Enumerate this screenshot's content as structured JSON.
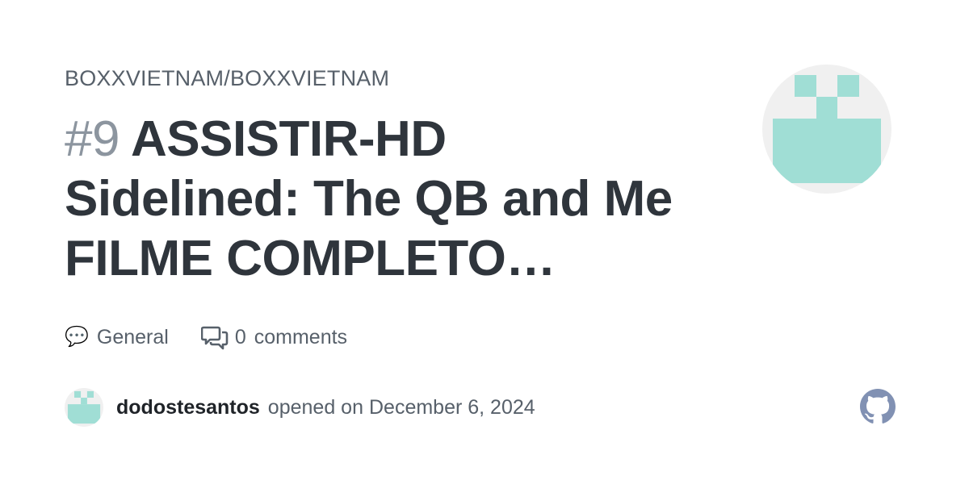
{
  "repo": {
    "path": "BOXXVIETNAM/BOXXVIETNAM"
  },
  "issue": {
    "number": "#9",
    "title": "ASSISTIR-HD Sidelined: The QB and Me FILME COMPLETO…"
  },
  "meta": {
    "category_label": "General",
    "category_icon": "speech-balloon-icon",
    "comment_count": "0",
    "comments_label": "comments"
  },
  "author": {
    "username": "dodostesantos",
    "opened_label": "opened on",
    "date": "December 6, 2024"
  },
  "colors": {
    "avatar_fill": "#a0ded5",
    "avatar_bg": "#f0f0f0",
    "github_icon": "#8191b3",
    "text_muted": "#57606a",
    "title": "#2f353c",
    "issue_number": "#8c959f"
  }
}
